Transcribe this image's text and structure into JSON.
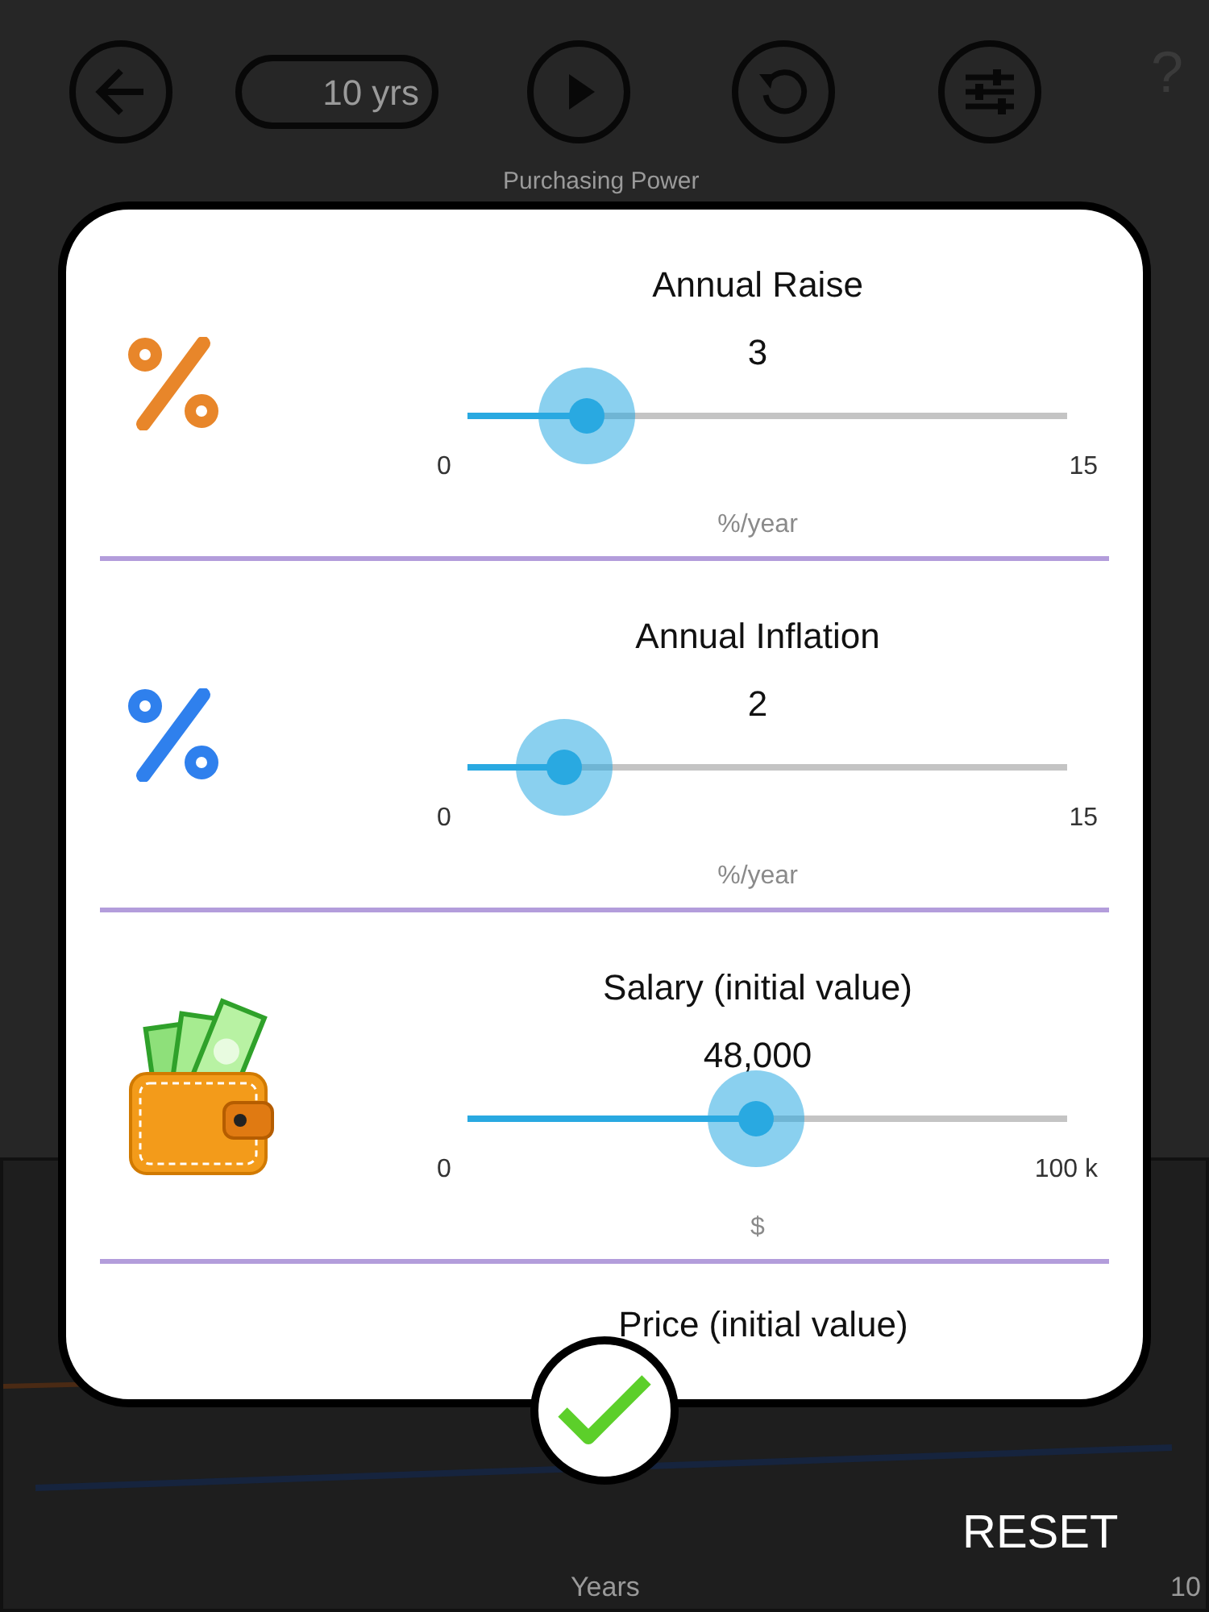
{
  "toolbar": {
    "period": "10 yrs",
    "help": "?"
  },
  "chart_title": "Purchasing Power",
  "chart": {
    "xlabel": "Years",
    "x_end_tick": "10"
  },
  "dialog": {
    "sections": [
      {
        "kind": "percent",
        "color": "#e8862a",
        "title": "Annual Raise",
        "value": "3",
        "min": "0",
        "max": "15",
        "unit": "%/year",
        "level": 0.2
      },
      {
        "kind": "percent",
        "color": "#2f80ed",
        "title": "Annual Inflation",
        "value": "2",
        "min": "0",
        "max": "15",
        "unit": "%/year",
        "level": 0.16
      },
      {
        "kind": "wallet",
        "title": "Salary (initial value)",
        "value": "48,000",
        "min": "0",
        "max": "100 k",
        "unit": "$",
        "level": 0.48
      },
      {
        "kind": "heading",
        "title": "Price (initial value)"
      }
    ]
  },
  "reset": "RESET"
}
